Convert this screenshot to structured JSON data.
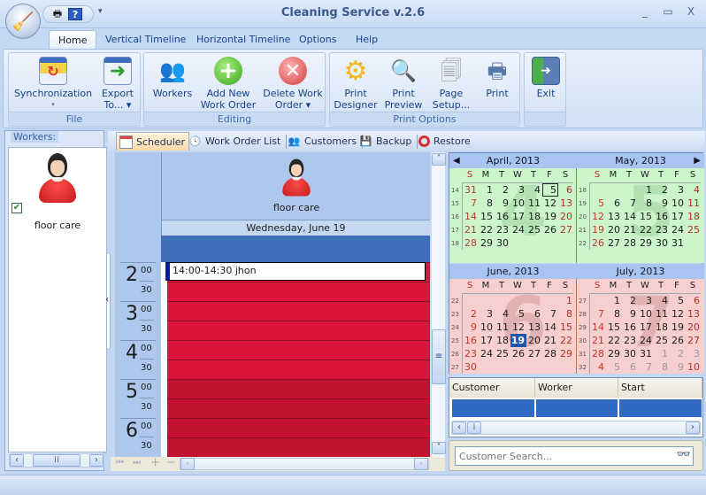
{
  "window": {
    "title": "Cleaning Service v.2.6",
    "app_icon": "cleaner-icon",
    "quick_access": [
      {
        "icon": "print-icon"
      },
      {
        "icon": "help-icon"
      }
    ],
    "controls": {
      "minimize": "_",
      "maximize": "▭",
      "close": "X"
    }
  },
  "ribbon": {
    "tabs": [
      {
        "label": "Home",
        "active": true
      },
      {
        "label": "Vertical Timeline"
      },
      {
        "label": "Horizontal Timeline"
      },
      {
        "label": "Options"
      },
      {
        "label": "Help"
      }
    ],
    "groups": {
      "file": {
        "label": "File",
        "buttons": [
          {
            "label1": "Synchronization",
            "label2": "▾",
            "icon": "sync-table-icon"
          },
          {
            "label1": "Export",
            "label2": "To... ▾",
            "icon": "export-table-icon"
          }
        ]
      },
      "editing": {
        "label": "Editing",
        "buttons": [
          {
            "label1": "Workers",
            "label2": "",
            "icon": "workers-icon"
          },
          {
            "label1": "Add New",
            "label2": "Work Order",
            "icon": "add-icon"
          },
          {
            "label1": "Delete Work",
            "label2": "Order ▾",
            "icon": "delete-icon"
          }
        ]
      },
      "print": {
        "label": "Print Options",
        "buttons": [
          {
            "label1": "Print",
            "label2": "Designer",
            "icon": "gear-icon"
          },
          {
            "label1": "Print",
            "label2": "Preview",
            "icon": "magnifier-icon"
          },
          {
            "label1": "Page",
            "label2": "Setup...",
            "icon": "pages-icon"
          },
          {
            "label1": "Print",
            "label2": "",
            "icon": "printer-icon"
          }
        ]
      },
      "exit": {
        "label": "",
        "buttons": [
          {
            "label1": "Exit",
            "label2": "",
            "icon": "exit-door-icon"
          }
        ]
      }
    }
  },
  "workers_panel": {
    "legend": "Workers:",
    "items": [
      {
        "name": "floor care",
        "checked": true
      }
    ]
  },
  "doc_tabs": [
    {
      "label": "Scheduler",
      "active": true,
      "icon": "calendar-grid-icon"
    },
    {
      "label": "Work Order List",
      "icon": "clock-icon"
    },
    {
      "label": "Customers",
      "icon": "people-icon"
    },
    {
      "label": "Backup",
      "icon": "backup-disk-icon"
    },
    {
      "label": "Restore",
      "icon": "lifebuoy-icon"
    }
  ],
  "scheduler": {
    "resource": "floor care",
    "date_header": "Wednesday, June 19",
    "appointment": "14:00-14:30 jhon",
    "hours": [
      {
        "hour": "2",
        "m1": "00",
        "m2": "30"
      },
      {
        "hour": "3",
        "m1": "00",
        "m2": "30"
      },
      {
        "hour": "4",
        "m1": "00",
        "m2": "30"
      },
      {
        "hour": "5",
        "m1": "00",
        "m2": "30"
      },
      {
        "hour": "6",
        "m1": "00",
        "m2": "30"
      }
    ],
    "colors": {
      "work_hours": "#dc143c",
      "after_hours": "#c41232",
      "all_day": "#3f6ebb"
    }
  },
  "calendars": {
    "day_names": [
      "S",
      "M",
      "T",
      "W",
      "T",
      "F",
      "S"
    ],
    "months": [
      {
        "title": "April, 2013",
        "big": "4",
        "tint": "green",
        "weeks": [
          "14",
          "15",
          "16",
          "17",
          "18"
        ],
        "days": [
          [
            "31",
            "1",
            "2",
            "3",
            "4",
            "5",
            "6"
          ],
          [
            "7",
            "8",
            "9",
            "10",
            "11",
            "12",
            "13"
          ],
          [
            "14",
            "15",
            "16",
            "17",
            "18",
            "19",
            "20"
          ],
          [
            "21",
            "22",
            "23",
            "24",
            "25",
            "26",
            "27"
          ],
          [
            "28",
            "29",
            "30",
            "",
            "",
            "",
            ""
          ]
        ],
        "boxed": "5",
        "nav": "prev"
      },
      {
        "title": "May, 2013",
        "big": "5",
        "tint": "green",
        "weeks": [
          "18",
          "19",
          "20",
          "21",
          "22"
        ],
        "days": [
          [
            "",
            "",
            "",
            "1",
            "2",
            "3",
            "4"
          ],
          [
            "5",
            "6",
            "7",
            "8",
            "9",
            "10",
            "11"
          ],
          [
            "12",
            "13",
            "14",
            "15",
            "16",
            "17",
            "18"
          ],
          [
            "19",
            "20",
            "21",
            "22",
            "23",
            "24",
            "25"
          ],
          [
            "26",
            "27",
            "28",
            "29",
            "30",
            "31",
            ""
          ]
        ],
        "nav": "next"
      },
      {
        "title": "June, 2013",
        "big": "6",
        "tint": "red",
        "weeks": [
          "22",
          "23",
          "24",
          "25",
          "26",
          "27"
        ],
        "days": [
          [
            "",
            "",
            "",
            "",
            "",
            "",
            "1"
          ],
          [
            "2",
            "3",
            "4",
            "5",
            "6",
            "7",
            "8"
          ],
          [
            "9",
            "10",
            "11",
            "12",
            "13",
            "14",
            "15"
          ],
          [
            "16",
            "17",
            "18",
            "19",
            "20",
            "21",
            "22"
          ],
          [
            "23",
            "24",
            "25",
            "26",
            "27",
            "28",
            "29"
          ],
          [
            "30",
            "",
            "",
            "",
            "",
            "",
            ""
          ]
        ],
        "selected": "19"
      },
      {
        "title": "July, 2013",
        "big": "7",
        "tint": "red",
        "weeks": [
          "27",
          "28",
          "29",
          "30",
          "31",
          "32"
        ],
        "days": [
          [
            "",
            "1",
            "2",
            "3",
            "4",
            "5",
            "6"
          ],
          [
            "7",
            "8",
            "9",
            "10",
            "11",
            "12",
            "13"
          ],
          [
            "14",
            "15",
            "16",
            "17",
            "18",
            "19",
            "20"
          ],
          [
            "21",
            "22",
            "23",
            "24",
            "25",
            "26",
            "27"
          ],
          [
            "28",
            "29",
            "30",
            "31",
            "1",
            "2",
            "3"
          ],
          [
            "4",
            "5",
            "6",
            "7",
            "8",
            "9",
            "10"
          ]
        ],
        "trailing_from_row": 4
      }
    ]
  },
  "orders_grid": {
    "columns": [
      "Customer",
      "Worker",
      "Start"
    ],
    "rows": [
      [
        "",
        "",
        ""
      ]
    ]
  },
  "search": {
    "placeholder": "Customer Search...",
    "icon": "binoculars-icon"
  }
}
